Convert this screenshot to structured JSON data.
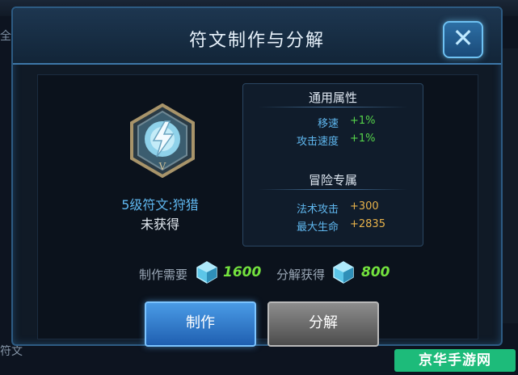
{
  "modal": {
    "title": "符文制作与分解",
    "close_icon": "close-icon"
  },
  "rune": {
    "name": "5级符文:狩猎",
    "status": "未获得",
    "icon": "rune-lightning-emblem-icon"
  },
  "attributes": {
    "general_title": "通用属性",
    "general": [
      {
        "label": "移速",
        "value": "+1%"
      },
      {
        "label": "攻击速度",
        "value": "+1%"
      }
    ],
    "adventure_title": "冒险专属",
    "adventure": [
      {
        "label": "法术攻击",
        "value": "+300"
      },
      {
        "label": "最大生命",
        "value": "+2835"
      }
    ]
  },
  "costs": {
    "make_label": "制作需要",
    "make_value": "1600",
    "decompose_label": "分解获得",
    "decompose_value": "800",
    "crystal_icon": "crystal-icon"
  },
  "buttons": {
    "make": "制作",
    "decompose": "分解"
  },
  "background": {
    "left_tab": "全",
    "bottom_label": "符文"
  },
  "watermark": "京华手游网",
  "colors": {
    "accent_blue": "#5fb7ef",
    "value_green": "#56d44a",
    "value_gold": "#e8b24a",
    "cost_green": "#74e33e"
  }
}
